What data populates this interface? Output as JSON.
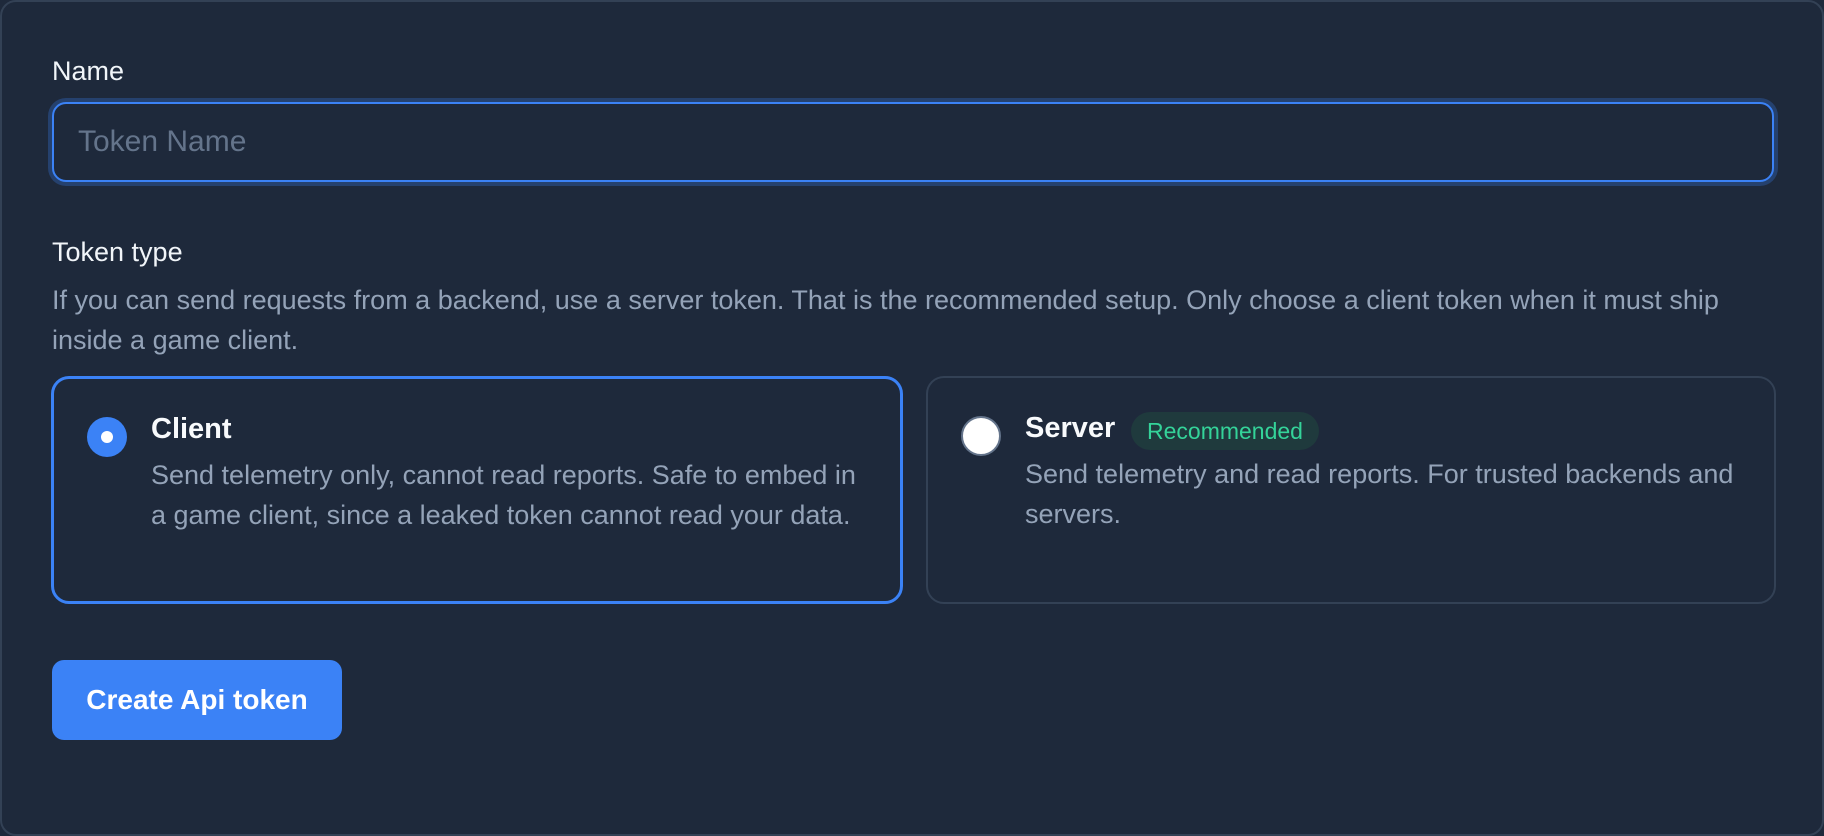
{
  "form": {
    "name_label": "Name",
    "name_placeholder": "Token Name",
    "name_value": "",
    "token_type_label": "Token type",
    "token_type_help": "If you can send requests from a backend, use a server token. That is the recommended setup. Only choose a client token when it must ship inside a game client.",
    "options": [
      {
        "title": "Client",
        "description": "Send telemetry only, cannot read reports. Safe to embed in a game client, since a leaked token cannot read your data.",
        "selected": true
      },
      {
        "title": "Server",
        "badge": "Recommended",
        "description": "Send telemetry and read reports. For trusted backends and servers.",
        "selected": false
      }
    ],
    "submit_label": "Create Api token"
  },
  "colors": {
    "background": "#1e293b",
    "accent": "#3b82f6",
    "badge_text": "#34d399",
    "muted_text": "#94a3b8"
  }
}
